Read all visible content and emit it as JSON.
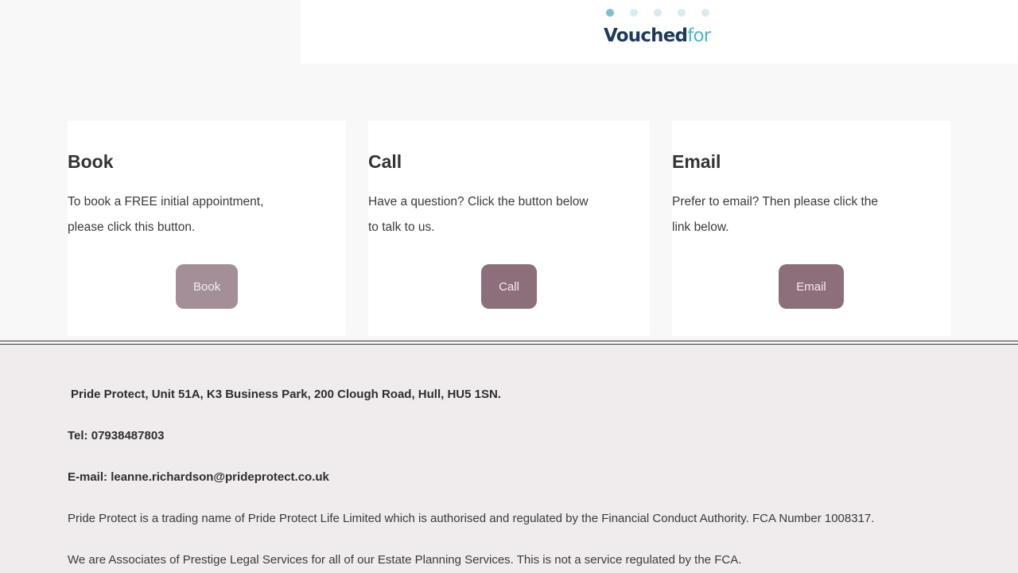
{
  "carousel": {
    "dots": [
      "slide-1",
      "slide-2",
      "slide-3",
      "slide-4",
      "slide-5"
    ],
    "active_index": 0,
    "logo": {
      "part1": "Vouched",
      "part2": "for"
    }
  },
  "cards": [
    {
      "title": "Book",
      "text_line1": "To book a FREE initial appointment,",
      "text_line2": "please click this button.",
      "button": "Book"
    },
    {
      "title": "Call",
      "text_line1": "Have a question? Click the button below",
      "text_line2": "to talk to us.",
      "button": "Call"
    },
    {
      "title": "Email",
      "text_line1": "Prefer to email? Then please click the",
      "text_line2": "link below.",
      "button": "Email"
    }
  ],
  "footer": {
    "address": "Pride Protect, Unit 51A, K3 Business Park, 200 Clough Road, Hull, HU5 1SN.",
    "tel_label": "Tel: ",
    "tel": "07938487803",
    "email_label": "E-mail: ",
    "email": "leanne.richardson@prideprotect.co.uk",
    "regulation": "Pride Protect is a trading name of Pride Protect Life Limited which is authorised and regulated by the Financial Conduct Authority. FCA Number 1008317.",
    "associates": "We are Associates of Prestige Legal Services for all of our Estate Planning Services. This is not a service regulated by the FCA."
  },
  "colors": {
    "button_faded": "#a48f98",
    "button_solid": "#8d6f7b",
    "dot_active": "#7ec1cc",
    "dot_inactive": "#d8ecef",
    "footer_bg": "#f0ecee"
  }
}
